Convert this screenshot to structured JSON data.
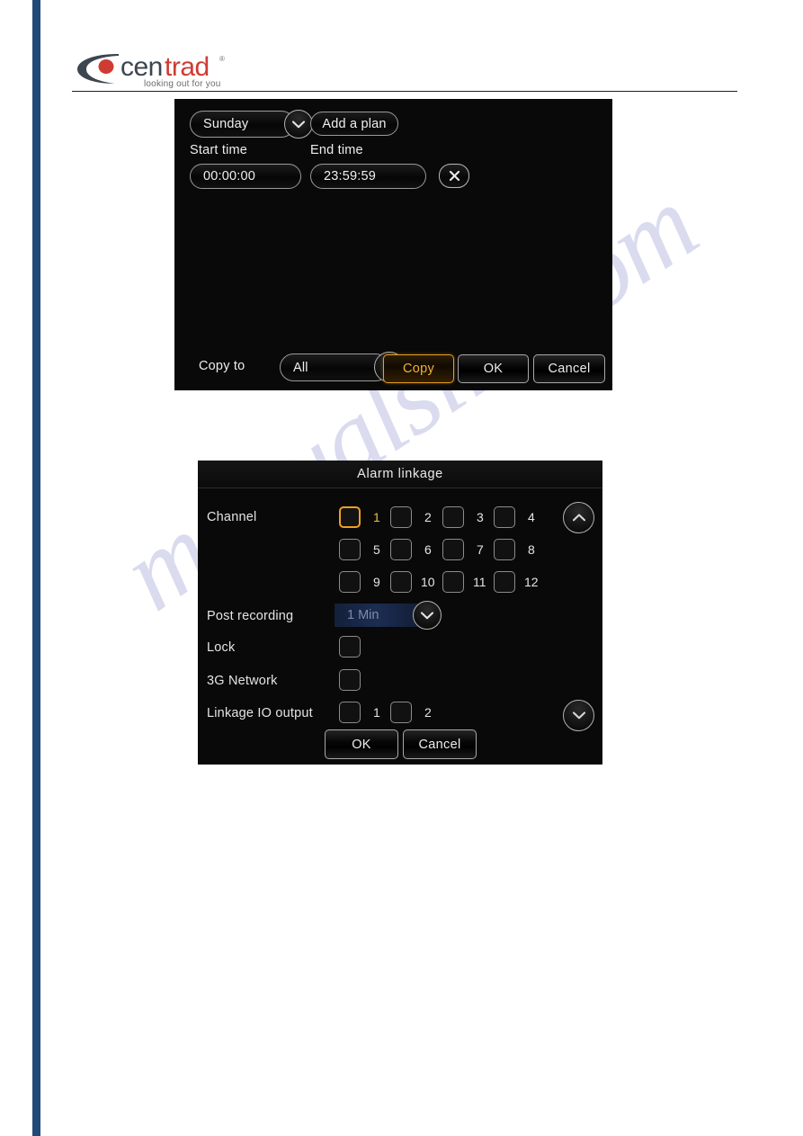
{
  "brand": {
    "name": "centrad",
    "name_part1": "cen",
    "name_part2": "trad",
    "registered_mark": "®",
    "tagline": "looking out for you"
  },
  "watermark": {
    "text": "manualslib.com"
  },
  "schedule_dialog": {
    "day_select": {
      "value": "Sunday",
      "chevron": "chevron-down-icon"
    },
    "add_plan_label": "Add a plan",
    "start_time_label": "Start time",
    "end_time_label": "End time",
    "rows": [
      {
        "start_time": "00:00:00",
        "end_time": "23:59:59",
        "delete_icon": "close-icon"
      }
    ],
    "copy_to_label": "Copy to",
    "copy_target": {
      "value": "All",
      "chevron": "chevron-down-icon"
    },
    "buttons": {
      "copy": "Copy",
      "ok": "OK",
      "cancel": "Cancel"
    },
    "accent_color": "#f0b233"
  },
  "alarm_dialog": {
    "title": "Alarm linkage",
    "channel_label": "Channel",
    "channels": [
      {
        "number": "1",
        "selected": true
      },
      {
        "number": "2",
        "selected": false
      },
      {
        "number": "3",
        "selected": false
      },
      {
        "number": "4",
        "selected": false
      },
      {
        "number": "5",
        "selected": false
      },
      {
        "number": "6",
        "selected": false
      },
      {
        "number": "7",
        "selected": false
      },
      {
        "number": "8",
        "selected": false
      },
      {
        "number": "9",
        "selected": false
      },
      {
        "number": "10",
        "selected": false
      },
      {
        "number": "11",
        "selected": false
      },
      {
        "number": "12",
        "selected": false
      }
    ],
    "post_recording_label": "Post recording",
    "post_recording_value": "1 Min",
    "post_recording_chevron": "chevron-down-icon",
    "lock_label": "Lock",
    "lock_checked": false,
    "network_label": "3G Network",
    "network_checked": false,
    "linkage_io_label": "Linkage IO output",
    "linkage_io": [
      {
        "number": "1",
        "selected": false
      },
      {
        "number": "2",
        "selected": false
      }
    ],
    "scroll_up_icon": "chevron-up-icon",
    "scroll_down_icon": "chevron-down-icon",
    "buttons": {
      "ok": "OK",
      "cancel": "Cancel"
    },
    "selected_color": "#f0a01e"
  }
}
